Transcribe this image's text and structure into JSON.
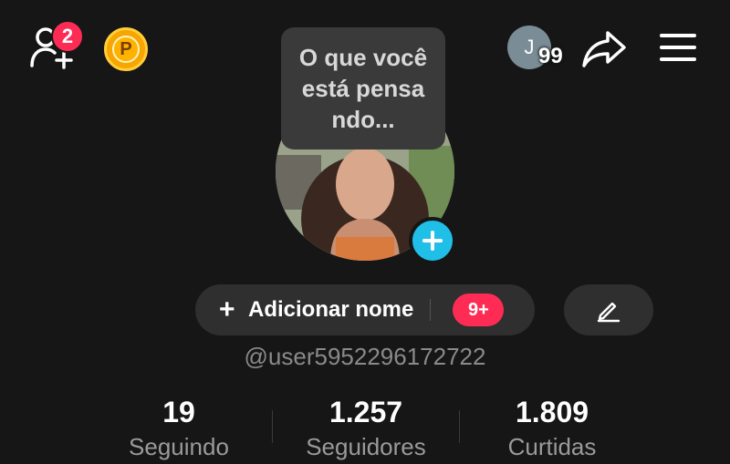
{
  "header": {
    "friend_requests_badge": "2",
    "coin_letter": "P",
    "account": {
      "initial": "J",
      "count": "99"
    }
  },
  "thought_bubble": {
    "text": "O que você está pensa ndo..."
  },
  "profile": {
    "add_name_plus": "+",
    "add_name_label": "Adicionar nome",
    "notification_badge": "9+",
    "username": "@user5952296172722"
  },
  "stats": [
    {
      "value": "19",
      "label": "Seguindo"
    },
    {
      "value": "1.257",
      "label": "Seguidores"
    },
    {
      "value": "1.809",
      "label": "Curtidas"
    }
  ],
  "icons": {
    "add_friends": "add-user-icon",
    "coin": "coin-icon",
    "share": "share-icon",
    "menu": "hamburger-menu-icon",
    "add_avatar": "plus-icon",
    "edit": "pencil-icon"
  },
  "colors": {
    "background": "#161616",
    "badge_red": "#fe2c55",
    "avatar_plus": "#20bfe8",
    "coin": "#f7a500"
  }
}
